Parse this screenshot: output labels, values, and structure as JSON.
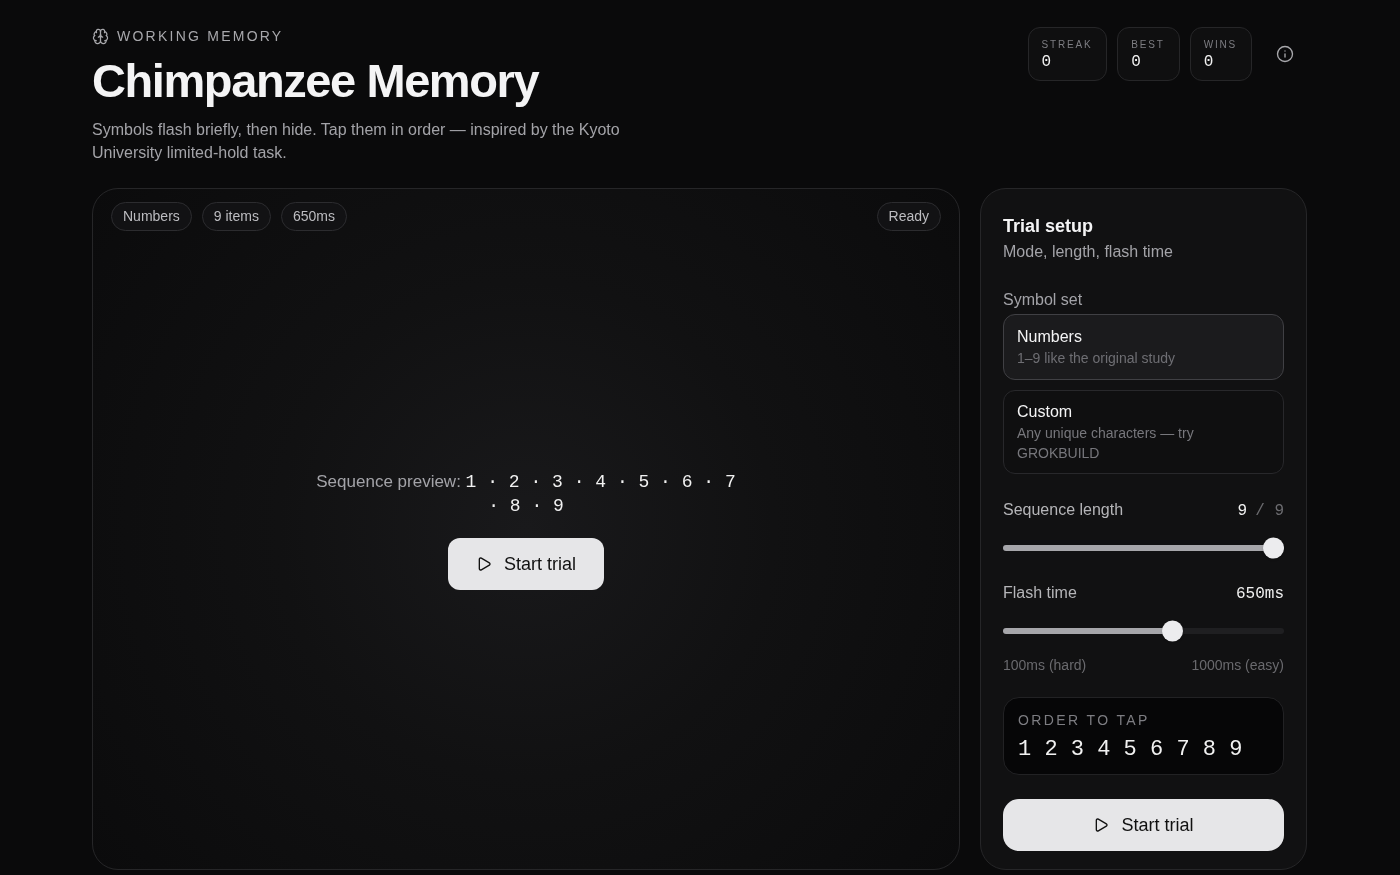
{
  "header": {
    "eyebrow": "WORKING MEMORY",
    "title": "Chimpanzee Memory",
    "description": "Symbols flash briefly, then hide. Tap them in order — inspired by the Kyoto University limited-hold task."
  },
  "stats": [
    {
      "label": "STREAK",
      "value": "0"
    },
    {
      "label": "BEST",
      "value": "0"
    },
    {
      "label": "WINS",
      "value": "0"
    }
  ],
  "stage": {
    "chips": [
      "Numbers",
      "9 items",
      "650ms"
    ],
    "status": "Ready",
    "preview": {
      "label": "Sequence preview:",
      "symbols": [
        "1",
        "2",
        "3",
        "4",
        "5",
        "6",
        "7",
        "8",
        "9"
      ],
      "separator": "·"
    },
    "start_button": "Start trial"
  },
  "setup": {
    "title": "Trial setup",
    "subtitle": "Mode, length, flash time",
    "symbol_set": {
      "label": "Symbol set",
      "options": [
        {
          "title": "Numbers",
          "description": "1–9 like the original study",
          "selected": true
        },
        {
          "title": "Custom",
          "description": "Any unique characters — try GROKBUILD",
          "selected": false
        }
      ]
    },
    "sliders": [
      {
        "label": "Sequence length",
        "value": "9",
        "max": "/ 9",
        "level": 1
      },
      {
        "label": "Flash time",
        "value": "650ms",
        "level": 0.61,
        "min_label": "100ms (hard)",
        "max_label": "1000ms (easy)"
      }
    ],
    "order": {
      "label": "ORDER TO TAP",
      "symbols": "1 2 3 4 5 6 7 8 9"
    },
    "start_button": "Start trial"
  }
}
